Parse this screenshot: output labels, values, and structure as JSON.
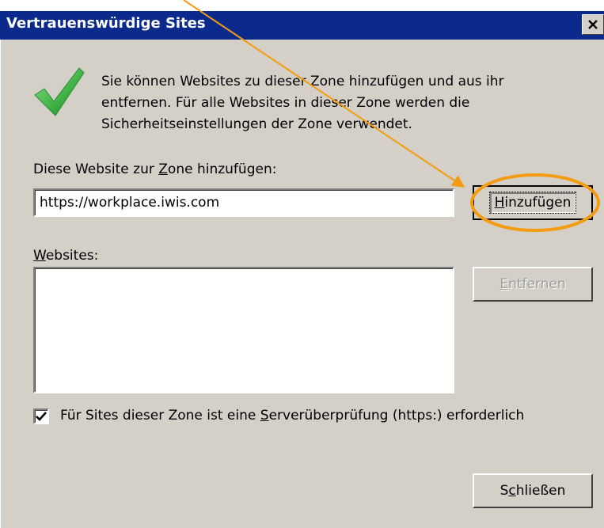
{
  "dialog": {
    "title": "Vertrauenswürdige Sites",
    "close_glyph": "✕",
    "description": "Sie können Websites zu dieser Zone hinzufügen und aus ihr entfernen. Für alle Websites in dieser Zone werden die Sicherheitseinstellungen der Zone verwendet.",
    "add_label": {
      "before": "Diese Website zur ",
      "accel": "Z",
      "after": "one hinzufügen:"
    },
    "url_value": "https://workplace.iwis.com",
    "add_button": {
      "accel": "H",
      "rest": "inzufügen"
    },
    "websites_label": {
      "accel": "W",
      "rest": "ebsites:"
    },
    "websites": [],
    "remove_button": {
      "accel": "E",
      "rest": "ntfernen"
    },
    "checkbox": {
      "checked": true,
      "label_before": "Für Sites dieser Zone ist eine ",
      "accel": "S",
      "label_after": "erverüberprüfung (https:) erforderlich"
    },
    "close_button": {
      "before": "S",
      "accel": "c",
      "after": "hließen"
    }
  },
  "colors": {
    "titlebar": "#0b2a8c",
    "dialog_face": "#d4d0c8",
    "annotation": "#f39c12",
    "checkmark": "#3cb043"
  },
  "icons": {
    "check": "check-icon",
    "close": "close-icon",
    "checkbox_mark": "checkbox-check-icon"
  }
}
